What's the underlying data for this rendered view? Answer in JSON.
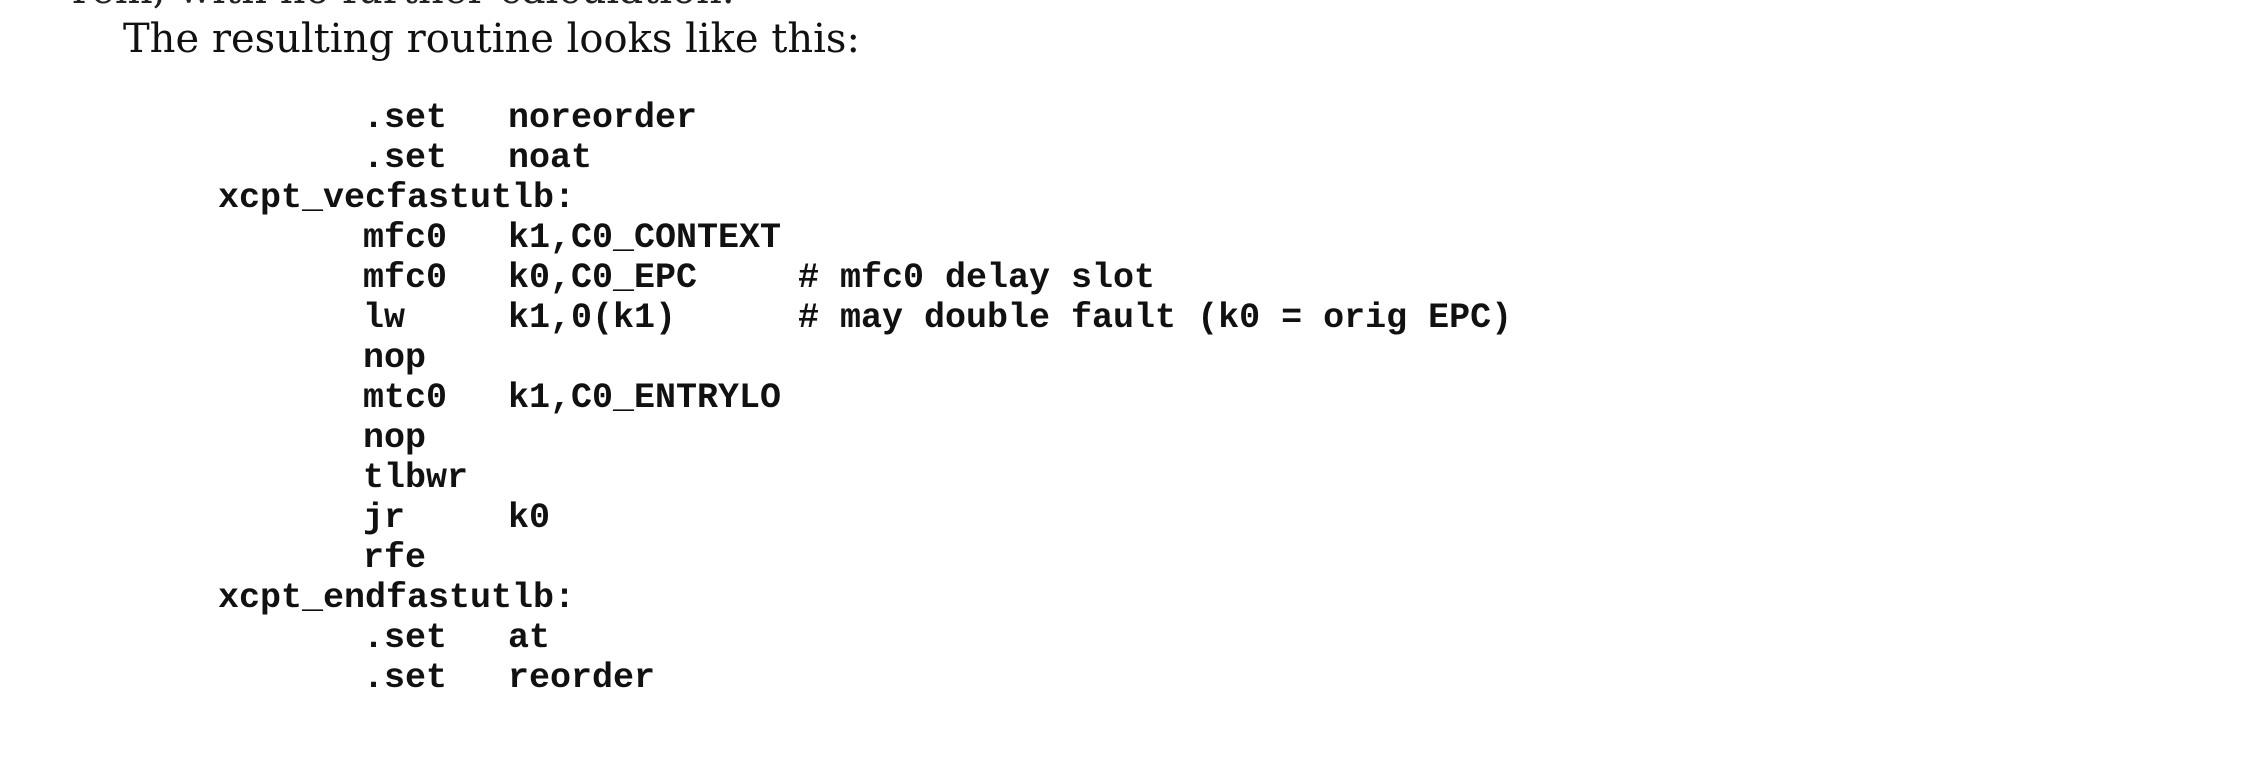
{
  "text": {
    "cut_line": "rem, with no further calculation.",
    "intro": "The resulting routine looks like this:"
  },
  "code": [
    {
      "label": "",
      "op": ".set",
      "args": "noreorder",
      "comment": ""
    },
    {
      "label": "",
      "op": ".set",
      "args": "noat",
      "comment": ""
    },
    {
      "label": "xcpt_vecfastutlb:",
      "op": "",
      "args": "",
      "comment": ""
    },
    {
      "label": "",
      "op": "mfc0",
      "args": "k1,C0_CONTEXT",
      "comment": ""
    },
    {
      "label": "",
      "op": "mfc0",
      "args": "k0,C0_EPC",
      "comment": "# mfc0 delay slot"
    },
    {
      "label": "",
      "op": "lw",
      "args": "k1,0(k1)",
      "comment": "# may double fault (k0 = orig EPC)"
    },
    {
      "label": "",
      "op": "nop",
      "args": "",
      "comment": ""
    },
    {
      "label": "",
      "op": "mtc0",
      "args": "k1,C0_ENTRYLO",
      "comment": ""
    },
    {
      "label": "",
      "op": "nop",
      "args": "",
      "comment": ""
    },
    {
      "label": "",
      "op": "tlbwr",
      "args": "",
      "comment": ""
    },
    {
      "label": "",
      "op": "jr",
      "args": "k0",
      "comment": ""
    },
    {
      "label": "",
      "op": "rfe",
      "args": "",
      "comment": ""
    },
    {
      "label": "xcpt_endfastutlb:",
      "op": "",
      "args": "",
      "comment": ""
    },
    {
      "label": "",
      "op": ".set",
      "args": "at",
      "comment": ""
    },
    {
      "label": "",
      "op": ".set",
      "args": "reorder",
      "comment": ""
    }
  ]
}
